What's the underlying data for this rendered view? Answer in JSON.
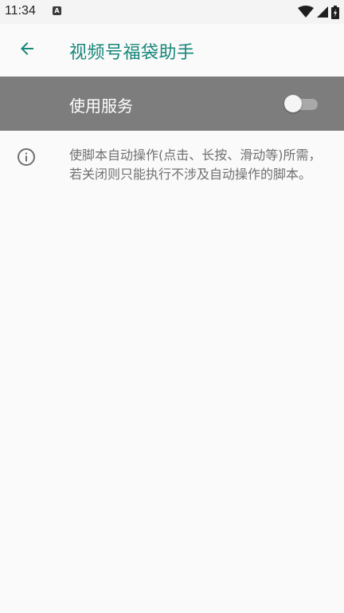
{
  "status_bar": {
    "time": "11:34",
    "notification_badge": "A",
    "icons": [
      "wifi-icon",
      "signal-icon",
      "battery-icon"
    ]
  },
  "app_bar": {
    "back_icon": "arrow-left-icon",
    "title": "视频号福袋助手"
  },
  "service": {
    "label": "使用服务",
    "enabled": false
  },
  "info": {
    "icon": "info-icon",
    "text": "使脚本自动操作(点击、长按、滑动等)所需，若关闭则只能执行不涉及自动操作的脚本。"
  },
  "colors": {
    "accent": "#17877a",
    "service_row_bg": "#7d7d7d",
    "background": "#fafafa",
    "info_text": "#707070"
  }
}
